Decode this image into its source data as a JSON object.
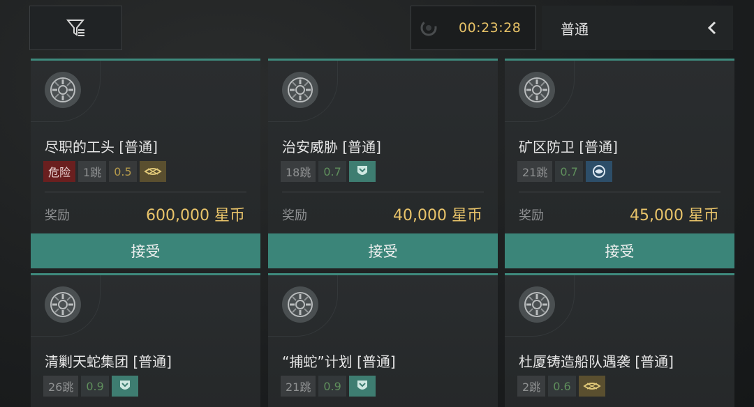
{
  "toolbar": {
    "filter_icon": "filter-icon",
    "timer": "00:23:28",
    "mode": "普通"
  },
  "colors": {
    "accent": "#3b8579",
    "gold": "#e9c46a",
    "danger": "#6a1f1f"
  },
  "missions": [
    {
      "title": "尽职的工头 [普通]",
      "tags": [
        "危险",
        "1跳",
        "0.5"
      ],
      "faction_icon": "gold-ship-icon",
      "reward_label": "奖励",
      "reward": "600,000 星币",
      "accept_label": "接受"
    },
    {
      "title": "治安威胁 [普通]",
      "tags": [
        "18跳",
        "0.7"
      ],
      "faction_icon": "teal-shield-icon",
      "reward_label": "奖励",
      "reward": "40,000 星币",
      "accept_label": "接受"
    },
    {
      "title": "矿区防卫 [普通]",
      "tags": [
        "21跳",
        "0.7"
      ],
      "faction_icon": "blue-eye-icon",
      "reward_label": "奖励",
      "reward": "45,000 星币",
      "accept_label": "接受"
    },
    {
      "title": "清剿天蛇集团 [普通]",
      "tags": [
        "26跳",
        "0.9"
      ],
      "faction_icon": "teal-shield-icon"
    },
    {
      "title": "“捕蛇”计划 [普通]",
      "tags": [
        "21跳",
        "0.9"
      ],
      "faction_icon": "teal-shield-icon"
    },
    {
      "title": "杜厦铸造船队遇袭 [普通]",
      "tags": [
        "2跳",
        "0.6"
      ],
      "faction_icon": "gold-ship-icon"
    }
  ]
}
